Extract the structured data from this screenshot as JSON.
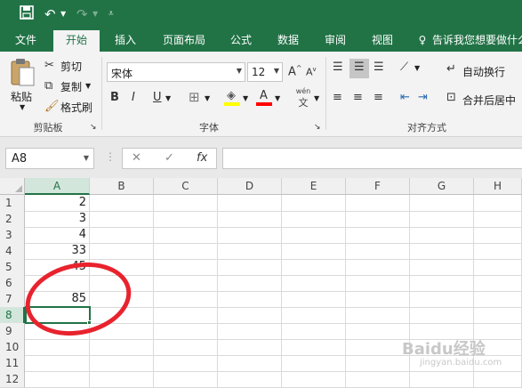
{
  "tabs": [
    {
      "label": "文件"
    },
    {
      "label": "开始"
    },
    {
      "label": "插入"
    },
    {
      "label": "页面布局"
    },
    {
      "label": "公式"
    },
    {
      "label": "数据"
    },
    {
      "label": "审阅"
    },
    {
      "label": "视图"
    }
  ],
  "tell_me": "告诉我您想要做什么",
  "clipboard": {
    "paste": "粘贴",
    "cut": "剪切",
    "copy": "复制",
    "format_painter": "格式刷",
    "group": "剪贴板"
  },
  "font": {
    "name": "宋体",
    "size": "12",
    "group": "字体",
    "bold": "B",
    "italic": "I",
    "underline": "U",
    "wen": "wén",
    "wen2": "文"
  },
  "alignment": {
    "wrap": "自动换行",
    "merge": "合并后居中",
    "group": "对齐方式"
  },
  "formula_bar": {
    "name_box": "A8",
    "cancel": "✕",
    "enter": "✓",
    "fx": "fx",
    "value": ""
  },
  "columns": [
    "A",
    "B",
    "C",
    "D",
    "E",
    "F",
    "G",
    "H"
  ],
  "rows": [
    "1",
    "2",
    "3",
    "4",
    "5",
    "6",
    "7",
    "8",
    "9",
    "10",
    "11",
    "12"
  ],
  "cells_a": [
    "2",
    "3",
    "4",
    "33",
    "45",
    "",
    "85",
    "",
    "",
    "",
    "",
    ""
  ],
  "active_cell": "A8",
  "watermark": "Baidu经验",
  "watermark_url": "jingyan.baidu.com",
  "colors": {
    "accent": "#217346",
    "annotation": "#e8232e"
  }
}
